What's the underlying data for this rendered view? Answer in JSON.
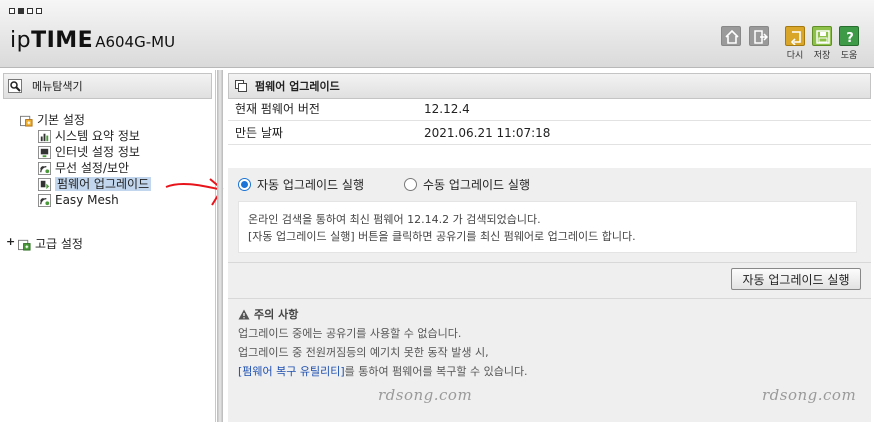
{
  "header": {
    "logo_prefix": "ip",
    "logo_bold": "TIME",
    "model": "A604G-MU",
    "buttons": [
      {
        "name": "home",
        "label": ""
      },
      {
        "name": "logout",
        "label": ""
      },
      {
        "name": "retry",
        "label": "다시"
      },
      {
        "name": "save",
        "label": "저장"
      },
      {
        "name": "help",
        "label": "도움"
      }
    ]
  },
  "sidebar": {
    "title": "메뉴탐색기",
    "basic_group": "기본 설정",
    "items": [
      {
        "label": "시스템 요약 정보"
      },
      {
        "label": "인터넷 설정 정보"
      },
      {
        "label": "무선 설정/보안"
      },
      {
        "label": "펌웨어 업그레이드"
      },
      {
        "label": "Easy Mesh"
      }
    ],
    "advanced_group": "고급 설정",
    "expand_symbol": "+"
  },
  "main": {
    "title": "펌웨어 업그레이드",
    "current_version_label": "현재 펌웨어 버전",
    "current_version_value": "12.12.4",
    "build_date_label": "만든 날짜",
    "build_date_value": "2021.06.21 11:07:18",
    "radio_auto": "자동 업그레이드 실행",
    "radio_manual": "수동 업그레이드 실행",
    "radio_selected": "auto",
    "message_line1": "온라인 검색을 통하여 최신 펌웨어 12.14.2 가 검색되었습니다.",
    "message_line2": "[자동 업그레이드 실행] 버튼을 클릭하면 공유기를 최신 펌웨어로 업그레이드 합니다.",
    "run_button": "자동 업그레이드 실행",
    "caution_title": "주의 사항",
    "caution_line1": "업그레이드 중에는 공유기를 사용할 수 없습니다.",
    "caution_line2": "업그레이드 중 전원꺼짐등의 예기치 못한 동작 발생 시,",
    "caution_link": "[펌웨어 복구 유틸리티]",
    "caution_line3_rest": "를 통하여 펌웨어를 복구할 수 있습니다."
  },
  "watermark": "rdsong.com",
  "colors": {
    "accent_radio": "#1a73d6",
    "link": "#1d4fb1",
    "annotation_arrow": "#e8141c",
    "selected_item_bg": "#c2d7ee"
  }
}
